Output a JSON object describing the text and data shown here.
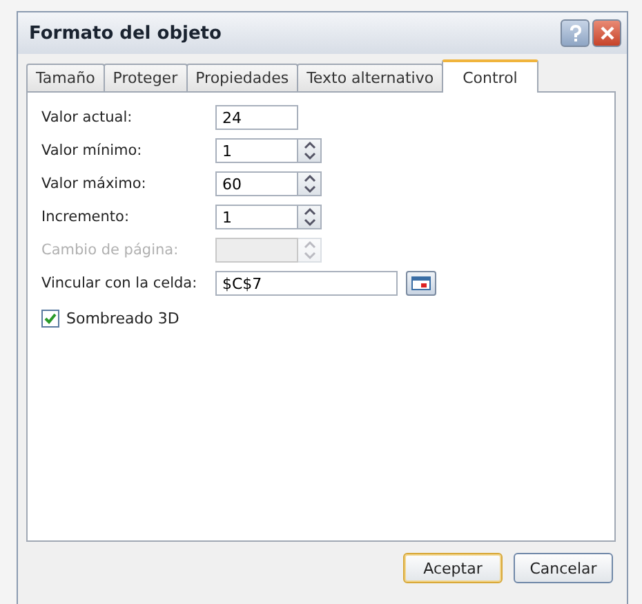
{
  "window": {
    "title": "Formato del objeto"
  },
  "tabs": [
    {
      "label": "Tamaño",
      "selected": false
    },
    {
      "label": "Proteger",
      "selected": false
    },
    {
      "label": "Propiedades",
      "selected": false
    },
    {
      "label": "Texto alternativo",
      "selected": false
    },
    {
      "label": "Control",
      "selected": true
    }
  ],
  "fields": [
    {
      "kind": "text",
      "label": "Valor actual:",
      "value": "24",
      "disabled": false
    },
    {
      "kind": "spin",
      "label": "Valor mínimo:",
      "value": "1",
      "disabled": false
    },
    {
      "kind": "spin",
      "label": "Valor máximo:",
      "value": "60",
      "disabled": false
    },
    {
      "kind": "spin",
      "label": "Incremento:",
      "value": "1",
      "disabled": false
    },
    {
      "kind": "spin",
      "label": "Cambio de página:",
      "disabled": true
    },
    {
      "kind": "link",
      "label": "Vincular con la celda:",
      "value": "$C$7",
      "disabled": false
    }
  ],
  "checkbox": {
    "label": "Sombreado 3D",
    "checked": true
  },
  "buttons": [
    {
      "label": "Aceptar",
      "default": true
    },
    {
      "label": "Cancelar",
      "default": false
    }
  ]
}
